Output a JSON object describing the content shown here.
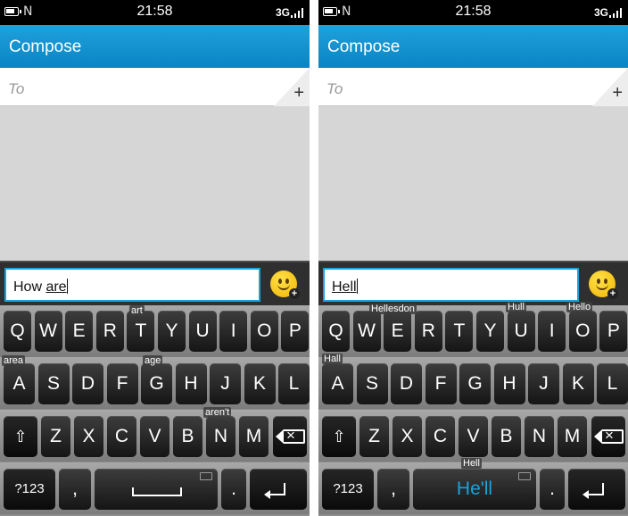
{
  "screens": [
    {
      "status": {
        "time": "21:58",
        "network": "3G",
        "nfc": "N"
      },
      "header": {
        "title": "Compose"
      },
      "to": {
        "placeholder": "To",
        "add": "+"
      },
      "input": {
        "text_prefix": "How ",
        "text_underlined": "are"
      },
      "emoji_plus": "+",
      "keys": {
        "row1": [
          "Q",
          "W",
          "E",
          "R",
          "T",
          "Y",
          "U",
          "I",
          "O",
          "P"
        ],
        "row2": [
          "A",
          "S",
          "D",
          "F",
          "G",
          "H",
          "J",
          "K",
          "L"
        ],
        "row3": [
          "Z",
          "X",
          "C",
          "V",
          "B",
          "N",
          "M"
        ],
        "symbols": "?123",
        "comma": ",",
        "period": "."
      },
      "suggestions": [
        "art",
        "area",
        "age",
        "aren't"
      ],
      "predicted_word": ""
    },
    {
      "status": {
        "time": "21:58",
        "network": "3G",
        "nfc": "N"
      },
      "header": {
        "title": "Compose"
      },
      "to": {
        "placeholder": "To",
        "add": "+"
      },
      "input": {
        "text_prefix": "",
        "text_underlined": "Hell"
      },
      "emoji_plus": "+",
      "keys": {
        "row1": [
          "Q",
          "W",
          "E",
          "R",
          "T",
          "Y",
          "U",
          "I",
          "O",
          "P"
        ],
        "row2": [
          "A",
          "S",
          "D",
          "F",
          "G",
          "H",
          "J",
          "K",
          "L"
        ],
        "row3": [
          "Z",
          "X",
          "C",
          "V",
          "B",
          "N",
          "M"
        ],
        "symbols": "?123",
        "comma": ",",
        "period": "."
      },
      "suggestions": [
        "Hellesdon",
        "Hull",
        "Hello",
        "Hall",
        "Hell"
      ],
      "predicted_word": "He'll"
    }
  ],
  "colors": {
    "accent": "#19a3dc",
    "header_top": "#1ea2dc",
    "header_bottom": "#0a84c4"
  },
  "icons": [
    "battery-icon",
    "nfc-icon",
    "signal-icon",
    "plus-icon",
    "emoji-icon",
    "shift-icon",
    "backspace-icon",
    "keyboard-icon",
    "mic-icon",
    "enter-icon"
  ]
}
